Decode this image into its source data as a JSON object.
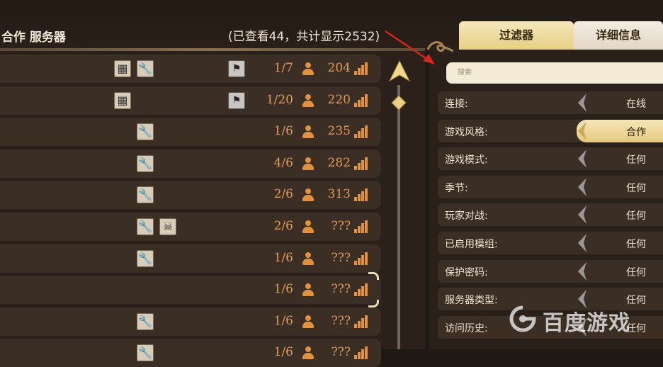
{
  "list_header": {
    "title": "合作 服务器",
    "count_text": "(已查看44，共计显示2532)"
  },
  "servers": [
    {
      "mods": [
        "server-icon",
        "wrench-icon"
      ],
      "flag": true,
      "players": "1/7",
      "ping": "204"
    },
    {
      "mods": [
        "server-icon"
      ],
      "flag": true,
      "players": "1/20",
      "ping": "220"
    },
    {
      "mods": [
        "wrench-icon"
      ],
      "flag": false,
      "players": "1/6",
      "ping": "235"
    },
    {
      "mods": [
        "wrench-icon"
      ],
      "flag": false,
      "players": "4/6",
      "ping": "282"
    },
    {
      "mods": [
        "wrench-icon"
      ],
      "flag": false,
      "players": "2/6",
      "ping": "313"
    },
    {
      "mods": [
        "wrench-icon",
        "skull-icon"
      ],
      "flag": false,
      "players": "2/6",
      "ping": "???"
    },
    {
      "mods": [
        "wrench-icon"
      ],
      "flag": false,
      "players": "1/6",
      "ping": "???"
    },
    {
      "mods": [],
      "flag": false,
      "players": "1/6",
      "ping": "???",
      "selected": true
    },
    {
      "mods": [
        "wrench-icon"
      ],
      "flag": false,
      "players": "1/6",
      "ping": "???"
    },
    {
      "mods": [
        "wrench-icon"
      ],
      "flag": false,
      "players": "1/6",
      "ping": "???"
    }
  ],
  "tabs": {
    "filter": "过滤器",
    "details": "详细信息"
  },
  "search": {
    "placeholder": "搜索"
  },
  "filters": [
    {
      "label": "连接:",
      "value": "在线"
    },
    {
      "label": "游戏风格:",
      "value": "合作",
      "highlighted": true
    },
    {
      "label": "游戏模式:",
      "value": "任何"
    },
    {
      "label": "季节:",
      "value": "任何"
    },
    {
      "label": "玩家对战:",
      "value": "任何"
    },
    {
      "label": "已启用模组:",
      "value": "任何"
    },
    {
      "label": "保护密码:",
      "value": "任何"
    },
    {
      "label": "服务器类型:",
      "value": "任何"
    },
    {
      "label": "访问历史:",
      "value": "任何"
    }
  ],
  "colors": {
    "accent": "#e2913f",
    "highlight": "#f4e7b8",
    "annotation_arrow": "#d9261c"
  },
  "watermark": {
    "text": "百度游戏"
  }
}
